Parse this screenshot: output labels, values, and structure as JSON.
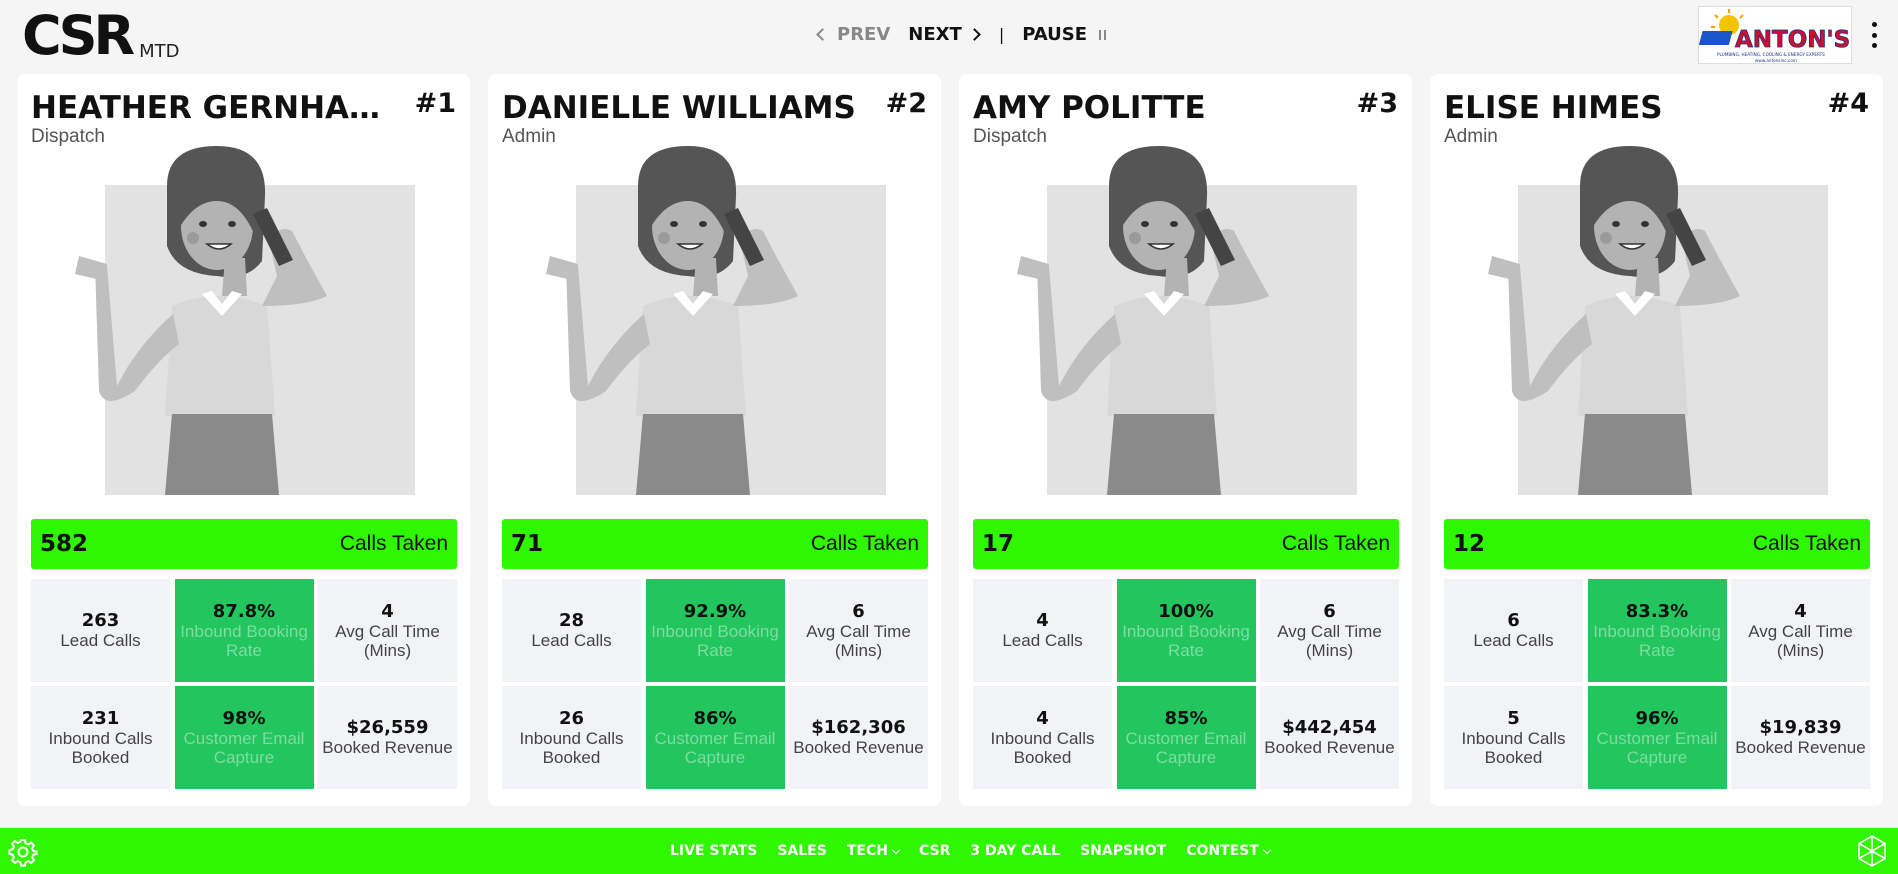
{
  "header": {
    "brand_main": "CSR",
    "brand_sub": "MTD",
    "prev_label": "PREV",
    "next_label": "NEXT",
    "separator": "|",
    "pause_label": "PAUSE",
    "logo_text": "ANTON'S",
    "logo_tagline": "PLUMBING, HEATING, COOLING & ENERGY EXPERTS",
    "logo_url": "www.antonsinc.com"
  },
  "labels": {
    "calls_taken": "Calls Taken",
    "lead_calls": "Lead Calls",
    "inbound_booking_rate": "Inbound Booking Rate",
    "avg_call_time": "Avg Call Time (Mins)",
    "inbound_calls_booked": "Inbound Calls Booked",
    "customer_email_capture": "Customer Email Capture",
    "booked_revenue": "Booked Revenue"
  },
  "cards": [
    {
      "name": "HEATHER GERNHARDT",
      "rank": "#1",
      "role": "Dispatch",
      "calls_taken": "582",
      "lead_calls": "263",
      "inbound_booking_rate": "87.8%",
      "avg_call_time": "4",
      "inbound_calls_booked": "231",
      "customer_email_capture": "98%",
      "booked_revenue": "$26,559"
    },
    {
      "name": "DANIELLE WILLIAMS",
      "rank": "#2",
      "role": "Admin",
      "calls_taken": "71",
      "lead_calls": "28",
      "inbound_booking_rate": "92.9%",
      "avg_call_time": "6",
      "inbound_calls_booked": "26",
      "customer_email_capture": "86%",
      "booked_revenue": "$162,306"
    },
    {
      "name": "AMY POLITTE",
      "rank": "#3",
      "role": "Dispatch",
      "calls_taken": "17",
      "lead_calls": "4",
      "inbound_booking_rate": "100%",
      "avg_call_time": "6",
      "inbound_calls_booked": "4",
      "customer_email_capture": "85%",
      "booked_revenue": "$442,454"
    },
    {
      "name": "ELISE HIMES",
      "rank": "#4",
      "role": "Admin",
      "calls_taken": "12",
      "lead_calls": "6",
      "inbound_booking_rate": "83.3%",
      "avg_call_time": "4",
      "inbound_calls_booked": "5",
      "customer_email_capture": "96%",
      "booked_revenue": "$19,839"
    }
  ],
  "footer": {
    "items": [
      {
        "label": "LIVE STATS",
        "dropdown": false
      },
      {
        "label": "SALES",
        "dropdown": false
      },
      {
        "label": "TECH",
        "dropdown": true
      },
      {
        "label": "CSR",
        "dropdown": false
      },
      {
        "label": "3 DAY CALL",
        "dropdown": false
      },
      {
        "label": "SNAPSHOT",
        "dropdown": false
      },
      {
        "label": "CONTEST",
        "dropdown": true
      }
    ]
  },
  "colors": {
    "accent_green": "#2ef700",
    "stat_green": "#22c55e",
    "stat_gray": "#f1f3f7"
  },
  "icons": [
    "chevron-left-icon",
    "chevron-right-icon",
    "pause-icon",
    "kebab-menu-icon",
    "gear-icon",
    "cube-network-icon",
    "avatar-illustration"
  ]
}
